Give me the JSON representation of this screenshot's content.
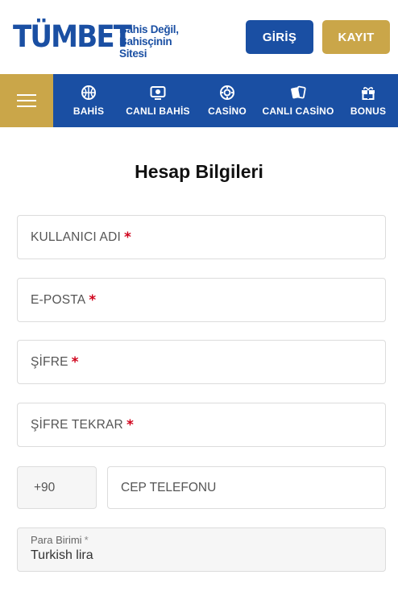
{
  "brand": {
    "name": "TÜMBET",
    "tagline_line1": "Bahis Değil,",
    "tagline_line2": "Bahisçinin Sitesi"
  },
  "header": {
    "login_label": "GİRİŞ",
    "register_label": "KAYIT"
  },
  "nav": {
    "items": [
      {
        "label": "BAHİS",
        "icon": "basketball-icon"
      },
      {
        "label": "CANLI BAHİS",
        "icon": "live-tv-icon"
      },
      {
        "label": "CASİNO",
        "icon": "chip-icon"
      },
      {
        "label": "CANLI CASİNO",
        "icon": "cards-icon"
      },
      {
        "label": "BONUS",
        "icon": "gift-icon"
      }
    ]
  },
  "form": {
    "title": "Hesap Bilgileri",
    "required_mark": "*",
    "username_placeholder": "KULLANICI ADI",
    "email_placeholder": "E-POSTA",
    "password_placeholder": "ŞİFRE",
    "password_repeat_placeholder": "ŞİFRE TEKRAR",
    "phone_code": "+90",
    "phone_placeholder": "CEP TELEFONU",
    "currency_label": "Para Birimi",
    "currency_value": "Turkish lira"
  },
  "colors": {
    "primary": "#1a4fa3",
    "accent": "#caa649",
    "required": "#d0021b"
  }
}
